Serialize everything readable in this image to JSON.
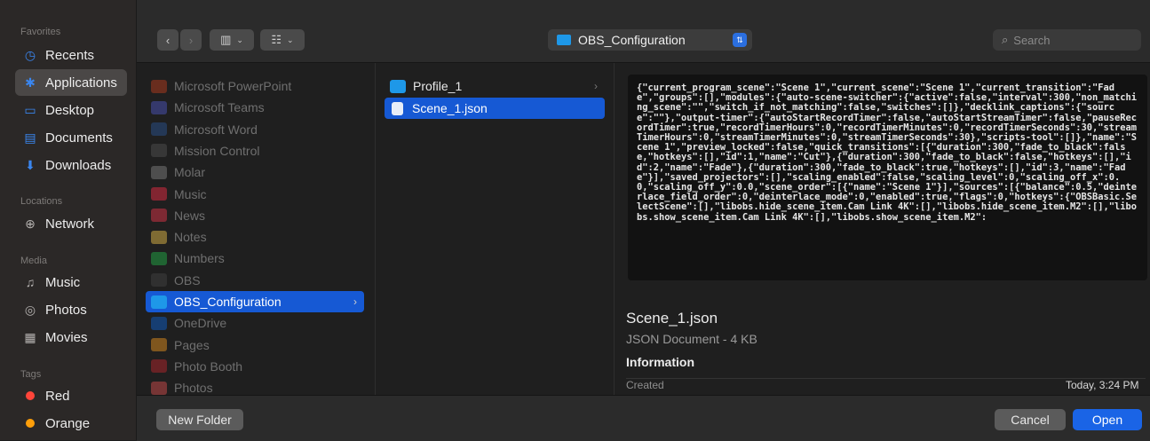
{
  "sidebar": {
    "sections": [
      {
        "title": "Favorites",
        "items": [
          {
            "label": "Recents",
            "icon": "clock-icon"
          },
          {
            "label": "Applications",
            "icon": "applications-icon",
            "selected": true
          },
          {
            "label": "Desktop",
            "icon": "desktop-icon"
          },
          {
            "label": "Documents",
            "icon": "document-icon"
          },
          {
            "label": "Downloads",
            "icon": "download-icon"
          }
        ]
      },
      {
        "title": "Locations",
        "items": [
          {
            "label": "Network",
            "icon": "globe-icon"
          }
        ]
      },
      {
        "title": "Media",
        "items": [
          {
            "label": "Music",
            "icon": "music-icon"
          },
          {
            "label": "Photos",
            "icon": "camera-icon"
          },
          {
            "label": "Movies",
            "icon": "film-icon"
          }
        ]
      },
      {
        "title": "Tags",
        "items": [
          {
            "label": "Red",
            "color": "#ff453a"
          },
          {
            "label": "Orange",
            "color": "#ff9f0a"
          }
        ]
      }
    ]
  },
  "toolbar": {
    "path": "OBS_Configuration",
    "search_placeholder": "Search"
  },
  "apps_column": [
    {
      "label": "Microsoft PowerPoint",
      "color": "#c43e1c"
    },
    {
      "label": "Microsoft Teams",
      "color": "#5059c9"
    },
    {
      "label": "Microsoft Word",
      "color": "#2b579a"
    },
    {
      "label": "Mission Control",
      "color": "#555555"
    },
    {
      "label": "Molar",
      "color": "#888888"
    },
    {
      "label": "Music",
      "color": "#fa2d48"
    },
    {
      "label": "News",
      "color": "#f0364b"
    },
    {
      "label": "Notes",
      "color": "#f5c84c"
    },
    {
      "label": "Numbers",
      "color": "#21b94a"
    },
    {
      "label": "OBS",
      "color": "#444444"
    },
    {
      "label": "OBS_Configuration",
      "color": "#1e98e8",
      "selected": true,
      "folder": true
    },
    {
      "label": "OneDrive",
      "color": "#0a64d8"
    },
    {
      "label": "Pages",
      "color": "#f49a1d"
    },
    {
      "label": "Photo Booth",
      "color": "#c0262c"
    },
    {
      "label": "Photos",
      "color": "#e05050"
    }
  ],
  "folder_column": [
    {
      "label": "Profile_1",
      "type": "folder"
    },
    {
      "label": "Scene_1.json",
      "type": "file",
      "selected": true
    }
  ],
  "preview": {
    "json_text": "{\"current_program_scene\":\"Scene 1\",\"current_scene\":\"Scene 1\",\"current_transition\":\"Fade\",\"groups\":[],\"modules\":{\"auto-scene-switcher\":{\"active\":false,\"interval\":300,\"non_matching_scene\":\"\",\"switch_if_not_matching\":false,\"switches\":[]},\"decklink_captions\":{\"source\":\"\"},\"output-timer\":{\"autoStartRecordTimer\":false,\"autoStartStreamTimer\":false,\"pauseRecordTimer\":true,\"recordTimerHours\":0,\"recordTimerMinutes\":0,\"recordTimerSeconds\":30,\"streamTimerHours\":0,\"streamTimerMinutes\":0,\"streamTimerSeconds\":30},\"scripts-tool\":[]},\"name\":\"Scene 1\",\"preview_locked\":false,\"quick_transitions\":[{\"duration\":300,\"fade_to_black\":false,\"hotkeys\":[],\"id\":1,\"name\":\"Cut\"},{\"duration\":300,\"fade_to_black\":false,\"hotkeys\":[],\"id\":2,\"name\":\"Fade\"},{\"duration\":300,\"fade_to_black\":true,\"hotkeys\":[],\"id\":3,\"name\":\"Fade\"}],\"saved_projectors\":[],\"scaling_enabled\":false,\"scaling_level\":0,\"scaling_off_x\":0.0,\"scaling_off_y\":0.0,\"scene_order\":[{\"name\":\"Scene 1\"}],\"sources\":[{\"balance\":0.5,\"deinterlace_field_order\":0,\"deinterlace_mode\":0,\"enabled\":true,\"flags\":0,\"hotkeys\":{\"OBSBasic.SelectScene\":[],\"libobs.hide_scene_item.Cam Link 4K\":[],\"libobs.hide_scene_item.M2\":[],\"libobs.show_scene_item.Cam Link 4K\":[],\"libobs.show_scene_item.M2\":",
    "filename": "Scene_1.json",
    "kind": "JSON Document - 4 KB",
    "info_heading": "Information",
    "created_label": "Created",
    "created_value": "Today, 3:24 PM"
  },
  "buttons": {
    "new_folder": "New Folder",
    "cancel": "Cancel",
    "open": "Open"
  },
  "colors": {
    "accent": "#1659d4",
    "open_button": "#1a64e6",
    "folder_blue": "#1e98e8"
  }
}
